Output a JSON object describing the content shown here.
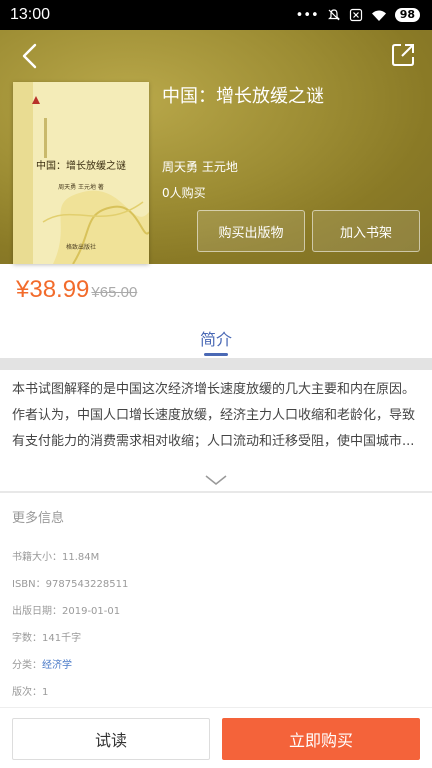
{
  "status_bar": {
    "time": "13:00",
    "battery": "98",
    "icons": [
      "dots-icon",
      "mute-icon",
      "sim-icon",
      "wifi-icon",
      "battery-icon"
    ]
  },
  "header": {
    "back_icon": "back-arrow-icon",
    "share_icon": "share-icon",
    "title": "中国：增长放缓之谜",
    "authors": "周天勇  王元地",
    "buyers": "0人购买",
    "buy_print_label": "购买出版物",
    "add_shelf_label": "加入书架"
  },
  "cover": {
    "title": "中国：增长放缓之谜",
    "authors": "周天勇 王元地 著",
    "publisher": "格致出版社"
  },
  "price": {
    "current": "¥38.99",
    "original": "¥65.00",
    "color": "#f26b2b"
  },
  "tabs": {
    "intro_label": "简介",
    "accent": "#4a69b5"
  },
  "intro": {
    "text": "本书试图解释的是中国这次经济增长速度放缓的几大主要和内在原因。作者认为，中国人口增长速度放缓，经济主力人口收缩和老龄化，导致有支付能力的消费需求相对收缩；人口流动和迁移受阻，使中国城市..."
  },
  "more_info": {
    "title": "更多信息",
    "size": "书籍大小：11.84M",
    "isbn": "ISBN：9787543228511",
    "pub_date": "出版日期：2019-01-01",
    "word_count": "字数：141千字",
    "category_label": "分类：",
    "category_value": "经济学",
    "edition": "版次：1"
  },
  "bottom_bar": {
    "trial_label": "试读",
    "buy_now_label": "立即购买",
    "buy_color": "#f4633a"
  }
}
